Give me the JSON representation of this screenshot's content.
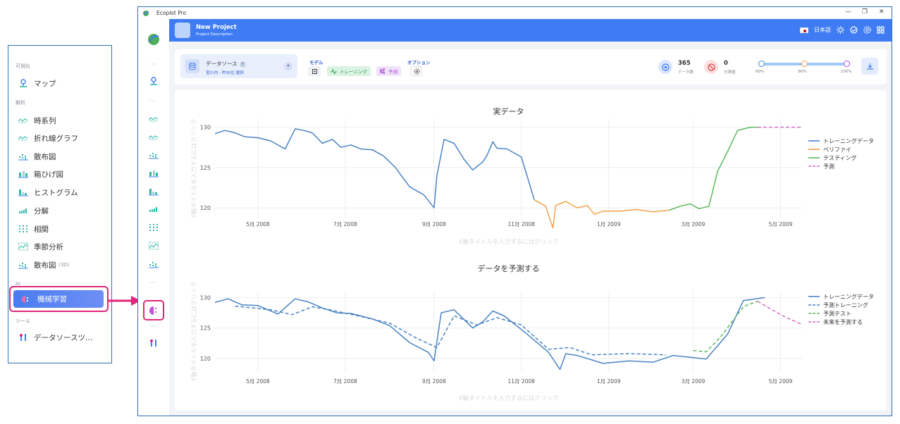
{
  "callout": {
    "sections": [
      {
        "label": "可視化",
        "items": [
          {
            "label": "マップ",
            "icon": "map-pin-icon"
          }
        ]
      },
      {
        "label": "解析",
        "items": [
          {
            "label": "時系列",
            "icon": "timeseries-icon"
          },
          {
            "label": "折れ線グラフ",
            "icon": "line-chart-icon"
          },
          {
            "label": "散布図",
            "icon": "scatter-icon"
          },
          {
            "label": "箱ひげ図",
            "icon": "boxplot-icon"
          },
          {
            "label": "ヒストグラム",
            "icon": "histogram-icon"
          },
          {
            "label": "分解",
            "icon": "decomposition-icon"
          },
          {
            "label": "相関",
            "icon": "correlation-icon"
          },
          {
            "label": "季節分析",
            "icon": "seasonal-icon"
          },
          {
            "label": "散布図",
            "sub": "(3D)",
            "icon": "scatter-3d-icon"
          }
        ]
      },
      {
        "label": "AI",
        "items": [
          {
            "label": "機械学習",
            "icon": "machine-learning-icon"
          }
        ]
      },
      {
        "label": "ツール",
        "items": [
          {
            "label": "データソースツ…",
            "icon": "tools-icon"
          }
        ]
      }
    ]
  },
  "window": {
    "title": "Ecoplot Pro",
    "controls": [
      "—",
      "❐",
      "✕"
    ]
  },
  "header": {
    "project_title": "New Project",
    "project_description": "Project Description",
    "language": "日本語"
  },
  "toolbar": {
    "datasource_label": "データソース",
    "datasource_help": "?",
    "datasource_value": "宮川内 - 貯水位 選択",
    "model_label": "モデル",
    "training_label": "トレーニング",
    "predict_label": "予測",
    "options_label": "オプション",
    "count_value": "365",
    "count_label": "データ数",
    "missing_value": "0",
    "missing_label": "欠測値",
    "split_values": [
      60,
      80,
      100
    ],
    "split_labels": [
      "60%",
      "80%",
      "100%"
    ]
  },
  "colors": {
    "accent": "#3f7cf3",
    "highlight": "#e0267a",
    "training": "#4a84c4",
    "verify": "#f5a04a",
    "testing": "#5cb85c",
    "forecast": "#d46fc8"
  },
  "chart_data": [
    {
      "type": "line",
      "title": "実データ",
      "xlabel": "X軸タイトルを入力するにはクリック",
      "ylabel": "Y軸タイトルを入力するにはクリック",
      "x_ticks": [
        "5月 2008",
        "7月 2008",
        "9月 2008",
        "11月 2008",
        "1月 2009",
        "3月 2009",
        "5月 2009"
      ],
      "y_ticks": [
        120,
        125,
        130
      ],
      "ylim": [
        118.7,
        131.1
      ],
      "xlim": [
        "2008-04-01",
        "2009-05-16"
      ],
      "legend_position": "right",
      "series": [
        {
          "name": "トレーニングデータ",
          "style": "solid",
          "color": "#4a84c4",
          "x": [
            "2008-04-01",
            "2008-04-08",
            "2008-04-15",
            "2008-04-22",
            "2008-05-01",
            "2008-05-10",
            "2008-05-20",
            "2008-05-27",
            "2008-06-02",
            "2008-06-08",
            "2008-06-15",
            "2008-06-22",
            "2008-06-28",
            "2008-07-05",
            "2008-07-12",
            "2008-07-20",
            "2008-07-28",
            "2008-08-05",
            "2008-08-15",
            "2008-08-25",
            "2008-09-01",
            "2008-09-03",
            "2008-09-08",
            "2008-09-15",
            "2008-09-22",
            "2008-09-28",
            "2008-10-05",
            "2008-10-08",
            "2008-10-12",
            "2008-10-15",
            "2008-10-22",
            "2008-11-01",
            "2008-11-10"
          ],
          "y": [
            129.2,
            129.6,
            129.3,
            128.8,
            128.7,
            128.3,
            127.3,
            129.8,
            129.6,
            129.3,
            128.0,
            128.5,
            127.5,
            127.8,
            127.3,
            127.2,
            126.4,
            125.0,
            122.6,
            121.6,
            120.0,
            124.0,
            128.5,
            128.0,
            126.0,
            124.7,
            125.7,
            126.5,
            128.2,
            127.4,
            127.3,
            126.3,
            121.0
          ]
        },
        {
          "name": "ベリファイ",
          "style": "solid",
          "color": "#f5a04a",
          "x": [
            "2008-11-10",
            "2008-11-18",
            "2008-11-23",
            "2008-11-25",
            "2008-12-02",
            "2008-12-10",
            "2008-12-17",
            "2008-12-22",
            "2008-12-28",
            "2009-01-10",
            "2009-01-20",
            "2009-02-01",
            "2009-02-12"
          ],
          "y": [
            121.0,
            120.2,
            117.5,
            120.3,
            120.8,
            120.0,
            120.3,
            119.2,
            119.6,
            119.6,
            119.8,
            119.5,
            119.7
          ]
        },
        {
          "name": "テスティング",
          "style": "solid",
          "color": "#5cb85c",
          "x": [
            "2009-02-12",
            "2009-02-20",
            "2009-02-27",
            "2009-03-05",
            "2009-03-12",
            "2009-03-18",
            "2009-03-25",
            "2009-04-01",
            "2009-04-10",
            "2009-04-15"
          ],
          "y": [
            119.7,
            120.2,
            120.5,
            119.9,
            120.2,
            124.5,
            127.0,
            129.6,
            130.0,
            130.0
          ]
        },
        {
          "name": "予測",
          "style": "dashed",
          "color": "#d46fc8",
          "x": [
            "2009-04-15",
            "2009-05-16"
          ],
          "y": [
            130.0,
            130.0
          ]
        }
      ]
    },
    {
      "type": "line",
      "title": "データを予測する",
      "xlabel": "X軸タイトルを入力するにはクリック",
      "ylabel": "Y軸タイトルを入力するにはクリック",
      "x_ticks": [
        "5月 2008",
        "7月 2008",
        "9月 2008",
        "11月 2008",
        "1月 2009",
        "3月 2009",
        "5月 2009"
      ],
      "y_ticks": [
        120,
        125,
        130
      ],
      "ylim": [
        117.8,
        131.1
      ],
      "xlim": [
        "2008-04-01",
        "2009-05-16"
      ],
      "legend_position": "right",
      "series": [
        {
          "name": "トレーニングデータ",
          "style": "solid",
          "color": "#4a84c4",
          "x": [
            "2008-04-01",
            "2008-04-10",
            "2008-04-20",
            "2008-05-01",
            "2008-05-15",
            "2008-05-27",
            "2008-06-05",
            "2008-06-15",
            "2008-06-25",
            "2008-07-05",
            "2008-07-20",
            "2008-08-01",
            "2008-08-15",
            "2008-08-28",
            "2008-09-01",
            "2008-09-06",
            "2008-09-15",
            "2008-09-28",
            "2008-10-05",
            "2008-10-12",
            "2008-10-20",
            "2008-11-05",
            "2008-11-20",
            "2008-11-28",
            "2008-12-02",
            "2008-12-10",
            "2008-12-28",
            "2009-01-15",
            "2009-02-01",
            "2009-02-15",
            "2009-02-27",
            "2009-03-10",
            "2009-03-25",
            "2009-04-05",
            "2009-04-20"
          ],
          "y": [
            129.2,
            129.8,
            128.8,
            128.7,
            127.3,
            129.8,
            129.3,
            128.3,
            127.5,
            127.4,
            126.5,
            125.4,
            122.6,
            121.0,
            119.6,
            127.5,
            128.0,
            125.0,
            126.0,
            127.8,
            127.0,
            124.0,
            121.0,
            118.2,
            120.8,
            120.5,
            119.2,
            119.6,
            119.4,
            120.5,
            120.2,
            119.9,
            124.0,
            129.5,
            130.0
          ]
        },
        {
          "name": "予測トレーニング",
          "style": "dashed",
          "color": "#4a84c4",
          "x": [
            "2008-04-15",
            "2008-05-10",
            "2008-05-25",
            "2008-06-08",
            "2008-06-20",
            "2008-07-10",
            "2008-08-01",
            "2008-08-20",
            "2008-09-03",
            "2008-09-15",
            "2008-10-01",
            "2008-10-15",
            "2008-11-01",
            "2008-11-20",
            "2008-12-05",
            "2008-12-20",
            "2009-01-15",
            "2009-02-10"
          ],
          "y": [
            128.6,
            128.0,
            127.2,
            128.5,
            128.0,
            127.0,
            125.8,
            123.3,
            121.8,
            127.0,
            125.5,
            126.7,
            125.5,
            121.5,
            121.8,
            120.6,
            120.8,
            120.6
          ]
        },
        {
          "name": "予測テスト",
          "style": "dashed",
          "color": "#5cb85c",
          "x": [
            "2009-03-01",
            "2009-03-10",
            "2009-03-20",
            "2009-04-05",
            "2009-04-15"
          ],
          "y": [
            121.3,
            121.1,
            123.5,
            128.5,
            129.4
          ]
        },
        {
          "name": "未来を予測する",
          "style": "dashed",
          "color": "#d46fc8",
          "x": [
            "2009-04-15",
            "2009-04-25",
            "2009-05-05",
            "2009-05-16"
          ],
          "y": [
            129.4,
            128.0,
            126.7,
            125.6
          ]
        }
      ]
    }
  ]
}
